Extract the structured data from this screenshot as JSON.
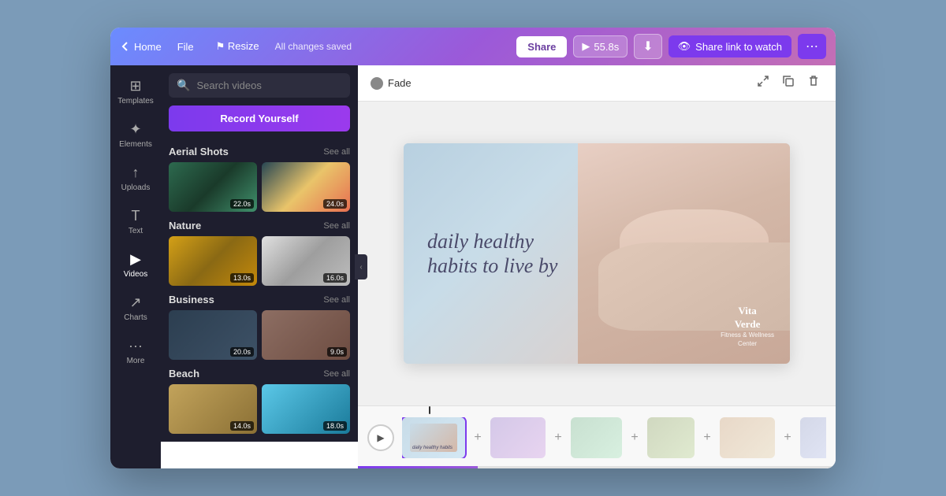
{
  "topbar": {
    "home_label": "Home",
    "file_label": "File",
    "resize_label": "Resize",
    "status": "All changes saved",
    "play_time": "55.8s",
    "share_label": "Share",
    "download_icon": "⬇",
    "share_link_label": "Share link to watch",
    "more_icon": "⋯"
  },
  "sidebar": {
    "items": [
      {
        "id": "templates",
        "icon": "⊞",
        "label": "Templates"
      },
      {
        "id": "elements",
        "icon": "✦",
        "label": "Elements"
      },
      {
        "id": "uploads",
        "icon": "↑",
        "label": "Uploads"
      },
      {
        "id": "text",
        "icon": "T",
        "label": "Text"
      },
      {
        "id": "videos",
        "icon": "▶",
        "label": "Videos",
        "active": true
      },
      {
        "id": "charts",
        "icon": "↗",
        "label": "Charts"
      },
      {
        "id": "more",
        "icon": "•••",
        "label": "More"
      }
    ]
  },
  "video_panel": {
    "search_placeholder": "Search videos",
    "record_button": "Record Yourself",
    "sections": [
      {
        "id": "aerial",
        "title": "Aerial Shots",
        "see_all": "See all",
        "clips": [
          {
            "id": "aerial1",
            "duration": "22.0s",
            "class": "thumb-aerial1"
          },
          {
            "id": "aerial2",
            "duration": "24.0s",
            "class": "thumb-aerial2"
          }
        ]
      },
      {
        "id": "nature",
        "title": "Nature",
        "see_all": "See all",
        "clips": [
          {
            "id": "nature1",
            "duration": "13.0s",
            "class": "thumb-nature1"
          },
          {
            "id": "nature2",
            "duration": "16.0s",
            "class": "thumb-nature2"
          }
        ]
      },
      {
        "id": "business",
        "title": "Business",
        "see_all": "See all",
        "clips": [
          {
            "id": "biz1",
            "duration": "20.0s",
            "class": "thumb-biz1"
          },
          {
            "id": "biz2",
            "duration": "9.0s",
            "class": "thumb-biz2"
          }
        ]
      },
      {
        "id": "beach",
        "title": "Beach",
        "see_all": "See all",
        "clips": [
          {
            "id": "beach1",
            "duration": "14.0s",
            "class": "thumb-beach1"
          },
          {
            "id": "beach2",
            "duration": "18.0s",
            "class": "thumb-beach2"
          }
        ]
      }
    ]
  },
  "canvas": {
    "transition_label": "Fade",
    "slide": {
      "headline_line1": "daily healthy",
      "headline_line2": "habits to live by",
      "brand_name": "Vita",
      "brand_name2": "Verde",
      "brand_sub": "Fitness & Wellness",
      "brand_sub2": "Center"
    }
  },
  "timeline": {
    "play_icon": "▶",
    "clips": [
      {
        "id": "tl1",
        "class": "tc1",
        "active": true
      },
      {
        "id": "tl2",
        "class": "tc2"
      },
      {
        "id": "tl3",
        "class": "tc3"
      },
      {
        "id": "tl4",
        "class": "tc4"
      },
      {
        "id": "tl5",
        "class": "tc5"
      },
      {
        "id": "tl6",
        "class": "tc6"
      }
    ]
  }
}
